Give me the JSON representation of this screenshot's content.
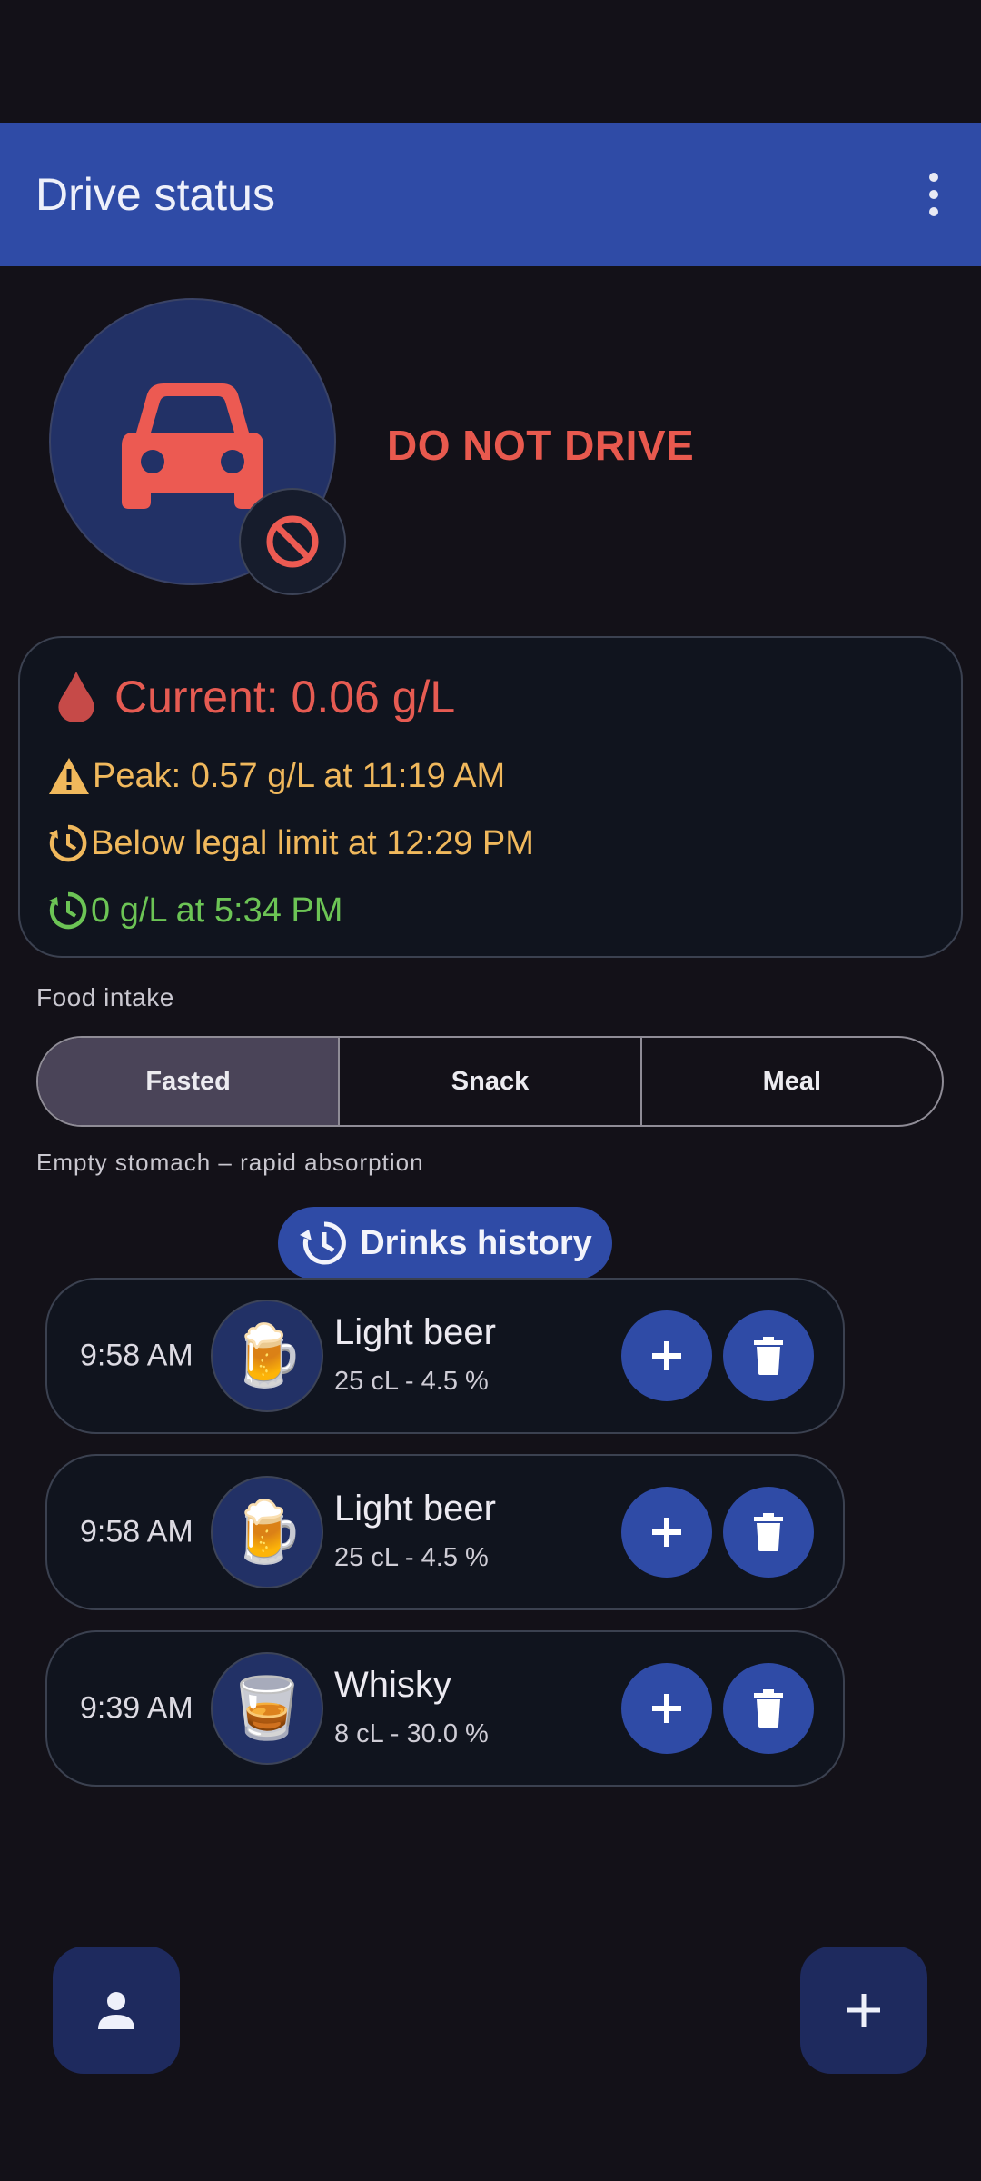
{
  "appbar": {
    "title": "Drive status",
    "menu_icon": "more-vert-icon"
  },
  "status": {
    "icon": "car-icon",
    "badge_icon": "block-icon",
    "text": "DO NOT DRIVE",
    "color": "#e8594e"
  },
  "bac": {
    "current": "Current: 0.06 g/L",
    "peak": "Peak: 0.57 g/L at 11:19 AM",
    "legal": "Below legal limit at 12:29 PM",
    "zero": "0 g/L at 5:34 PM"
  },
  "food": {
    "label": "Food intake",
    "options": [
      "Fasted",
      "Snack",
      "Meal"
    ],
    "selected": "Fasted",
    "description": "Empty stomach – rapid absorption"
  },
  "history": {
    "label": "Drinks history",
    "drinks": [
      {
        "time": "9:58 AM",
        "emoji": "🍺",
        "name": "Light beer",
        "detail": "25 cL - 4.5 %"
      },
      {
        "time": "9:58 AM",
        "emoji": "🍺",
        "name": "Light beer",
        "detail": "25 cL - 4.5 %"
      },
      {
        "time": "9:39 AM",
        "emoji": "🥃",
        "name": "Whisky",
        "detail": "8 cL - 30.0 %"
      }
    ]
  },
  "colors": {
    "accent": "#2f4ba6",
    "danger": "#e8594e",
    "warning": "#f0b85c",
    "ok": "#6cc455"
  }
}
